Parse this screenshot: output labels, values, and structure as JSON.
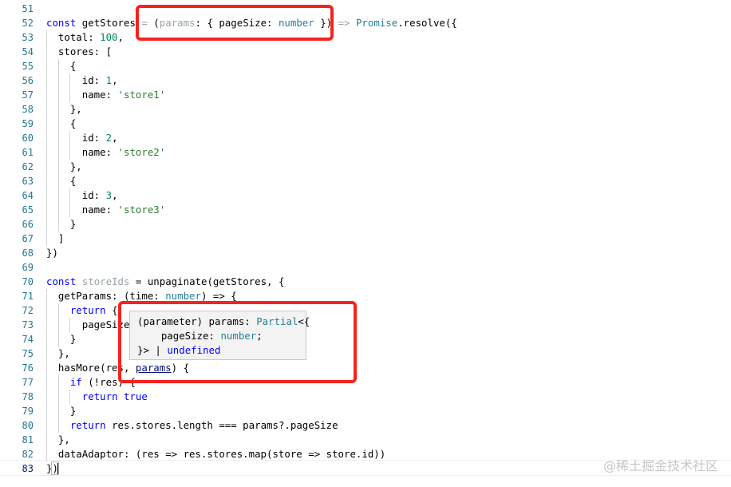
{
  "editor": {
    "line_numbers": [
      "51",
      "52",
      "53",
      "54",
      "55",
      "56",
      "57",
      "58",
      "59",
      "60",
      "61",
      "62",
      "63",
      "64",
      "65",
      "66",
      "67",
      "68",
      "69",
      "70",
      "71",
      "72",
      "73",
      "74",
      "75",
      "76",
      "77",
      "78",
      "79",
      "80",
      "81",
      "82",
      "83"
    ],
    "active_line": "83",
    "tooltip": {
      "line1_prefix": "(parameter) params: ",
      "line1_type": "Partial",
      "line1_suffix": "<{",
      "line2_prefix": "    pageSize: ",
      "line2_type": "number",
      "line2_suffix": ";",
      "line3_prefix": "}> | ",
      "line3_type": "undefined"
    }
  },
  "watermark": "@稀土掘金技术社区",
  "colors": {
    "highlight_border": "#f5231d",
    "line_number": "#237893",
    "keyword": "#0000ff",
    "number": "#098658",
    "string": "#2e7d32"
  }
}
